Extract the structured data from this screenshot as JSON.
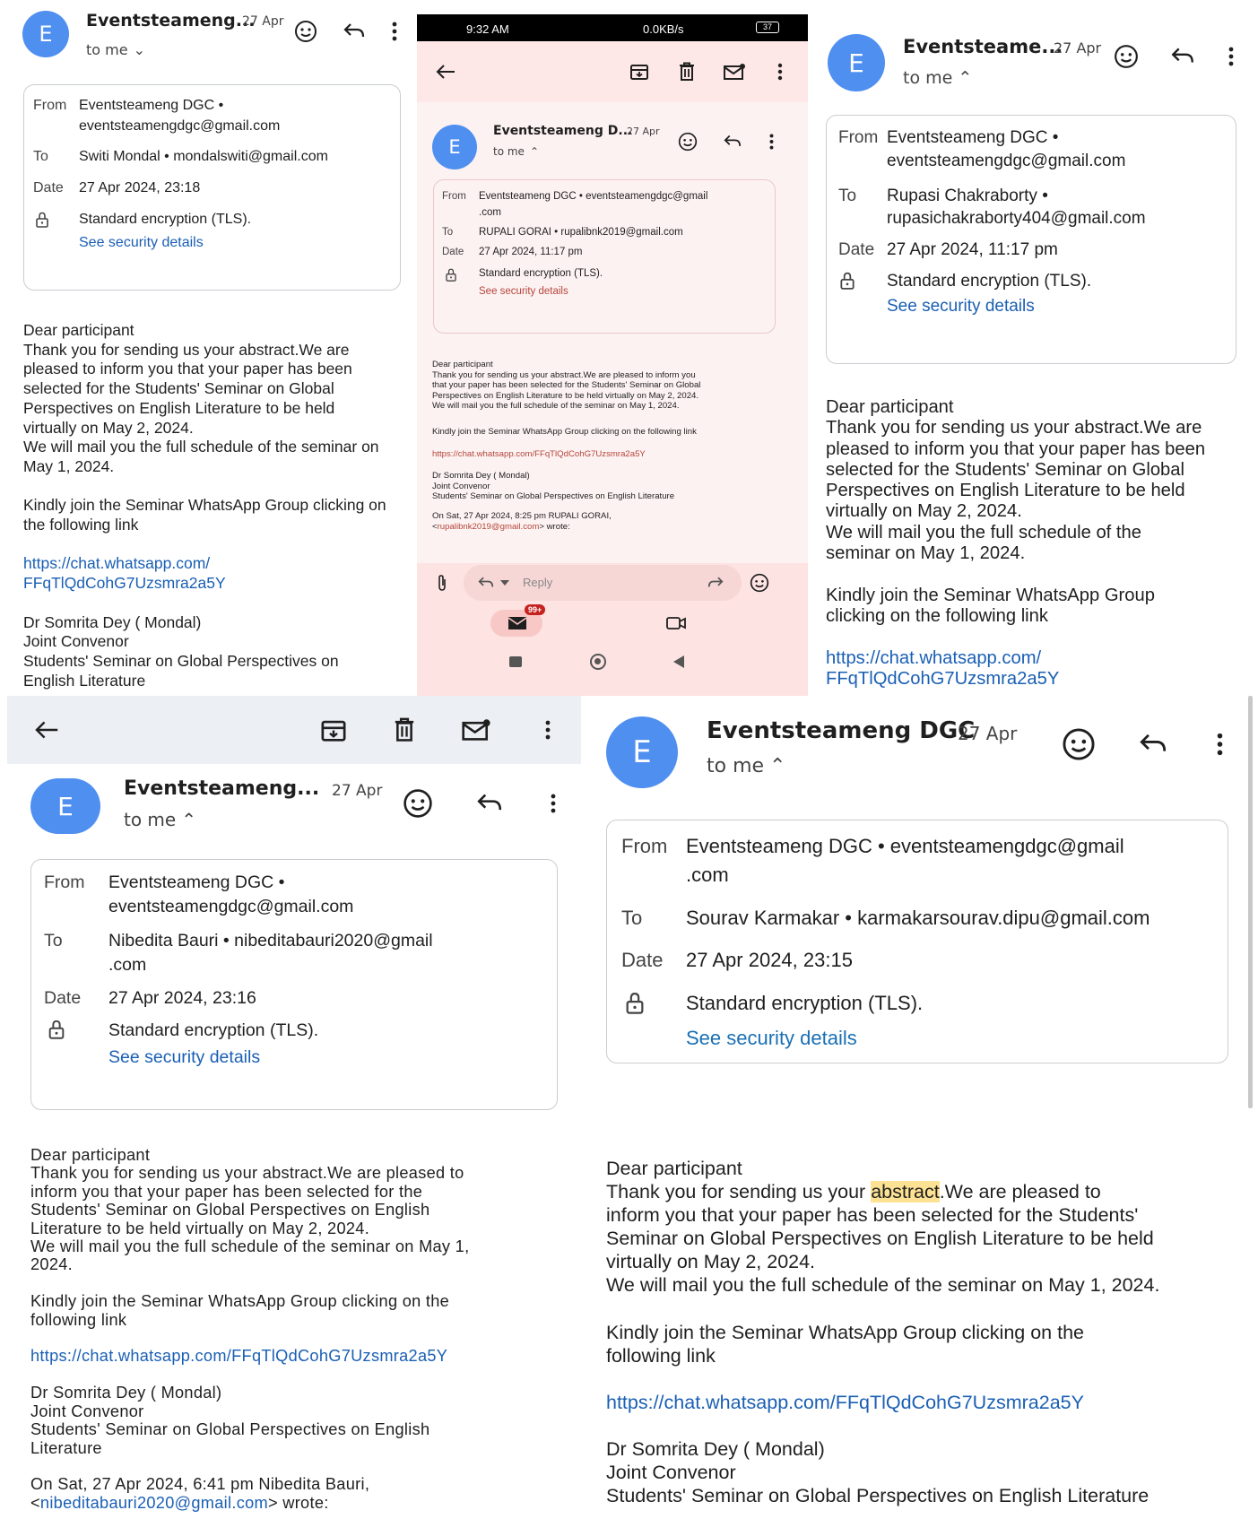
{
  "avatar_letter": "E",
  "panel1": {
    "sender": "Eventsteameng...",
    "date": "27 Apr",
    "recipient_line": "to me",
    "from_label": "From",
    "from_name": "Eventsteameng DGC •",
    "from_email": "eventsteamengdgc@gmail.com",
    "to_label": "To",
    "to_value": "Switi Mondal • mondalswiti@gmail.com",
    "date_label": "Date",
    "date_value": "27 Apr 2024, 23:18",
    "encryption": "Standard encryption (TLS).",
    "security_link": "See security details",
    "body": [
      "Dear participant",
      "Thank you for sending us your abstract.We are",
      "pleased to inform you that your paper has been",
      "selected for the Students' Seminar on Global",
      "Perspectives on English Literature to be held",
      "virtually on May 2, 2024.",
      "We will mail you the full schedule of the seminar on",
      "May 1, 2024.",
      "",
      "Kindly join the Seminar WhatsApp Group clicking on",
      "the following link",
      ""
    ],
    "link_lines": [
      "https://chat.whatsapp.com/",
      "FFqTlQdCohG7Uzsmra2a5Y"
    ],
    "signature": [
      "Dr Somrita Dey ( Mondal)",
      "Joint Convenor",
      "Students' Seminar on Global Perspectives on",
      "English Literature"
    ]
  },
  "panel2": {
    "status_time": "9:32 AM",
    "status_right": "0.0KB/s",
    "battery": "37",
    "sender": "Eventsteameng D...",
    "date": "27 Apr",
    "recipient_line": "to me",
    "from_label": "From",
    "from_value": "Eventsteameng DGC • eventsteamengdgc@gmail",
    "from_value_2": ".com",
    "to_label": "To",
    "to_value": "RUPALI GORAI • rupalibnk2019@gmail.com",
    "date_label": "Date",
    "date_value": "27 Apr 2024, 11:17 pm",
    "encryption": "Standard encryption (TLS).",
    "security_link": "See security details",
    "body": [
      "Dear participant",
      "Thank you for sending us your abstract.We are pleased to inform you",
      "that your paper has been selected for the Students' Seminar on Global",
      "Perspectives on English Literature to be held virtually on May 2, 2024.",
      "We will mail you the full schedule of the seminar on May 1, 2024."
    ],
    "join_line": "Kindly join the Seminar WhatsApp Group clicking on the following link",
    "link": "https://chat.whatsapp.com/FFqTlQdCohG7Uzsmra2a5Y",
    "signature": [
      "Dr Somrita Dey ( Mondal)",
      "Joint Convenor",
      "Students' Seminar on Global Perspectives on English Literature"
    ],
    "quote_line_1": "On Sat, 27 Apr 2024, 8:25 pm RUPALI GORAI,",
    "quote_email": "rupalibnk2019@gmail.com",
    "quote_line_2_pre": "<",
    "quote_line_2_post": "> wrote:",
    "reply_label": "Reply",
    "badge": "99+"
  },
  "panel3": {
    "sender": "Eventsteame...",
    "date": "27 Apr",
    "recipient_line": "to me",
    "from_label": "From",
    "from_name": "Eventsteameng DGC •",
    "from_email": "eventsteamengdgc@gmail.com",
    "to_label": "To",
    "to_name": "Rupasi Chakraborty •",
    "to_email": "rupasichakraborty404@gmail.com",
    "date_label": "Date",
    "date_value": "27 Apr 2024, 11:17 pm",
    "encryption": "Standard encryption (TLS).",
    "security_link": "See security details",
    "body": [
      "Dear participant",
      "Thank you for sending us your abstract.We are",
      "pleased to inform you that your paper has been",
      "selected for the Students' Seminar on Global",
      "Perspectives on English Literature to be held",
      "virtually on May 2, 2024.",
      "We will mail you the full schedule of the",
      "seminar on May 1, 2024.",
      "",
      "Kindly join the Seminar WhatsApp Group",
      "clicking on the following link",
      ""
    ],
    "link_lines": [
      "https://chat.whatsapp.com/",
      "FFqTlQdCohG7Uzsmra2a5Y"
    ]
  },
  "panel4": {
    "sender": "Eventsteameng...",
    "date": "27 Apr",
    "recipient_line": "to me",
    "from_label": "From",
    "from_name": "Eventsteameng DGC •",
    "from_email": "eventsteamengdgc@gmail.com",
    "to_label": "To",
    "to_value": "Nibedita Bauri • nibeditabauri2020@gmail",
    "to_value_2": ".com",
    "date_label": "Date",
    "date_value": "27 Apr 2024, 23:16",
    "encryption": "Standard encryption (TLS).",
    "security_link": "See security details",
    "body": [
      "Dear participant",
      "Thank you for sending us your abstract.We are pleased to",
      "inform you that your paper has been selected for the",
      "Students' Seminar on Global Perspectives on English",
      "Literature to be held virtually on May 2, 2024.",
      "We will mail you the full schedule of the seminar on May 1,",
      "2024.",
      "",
      "Kindly join the Seminar WhatsApp Group clicking on the",
      "following link",
      ""
    ],
    "link": "https://chat.whatsapp.com/FFqTlQdCohG7Uzsmra2a5Y",
    "signature": [
      "Dr Somrita Dey ( Mondal)",
      "Joint Convenor",
      "Students' Seminar on Global Perspectives on English",
      "Literature"
    ],
    "quote_line_1": "On Sat, 27 Apr 2024, 6:41 pm Nibedita Bauri,",
    "quote_pre": "<",
    "quote_email": "nibeditabauri2020@gmail.com",
    "quote_post": "> wrote:"
  },
  "panel5": {
    "sender": "Eventsteameng DGC",
    "date": "27 Apr",
    "recipient_line": "to me",
    "from_label": "From",
    "from_value": "Eventsteameng DGC • eventsteamengdgc@gmail",
    "from_value_2": ".com",
    "to_label": "To",
    "to_value": "Sourav Karmakar • karmakarsourav.dipu@gmail.com",
    "date_label": "Date",
    "date_value": "27 Apr 2024, 23:15",
    "encryption": "Standard encryption (TLS).",
    "security_link": "See security details",
    "body_1": "Dear participant",
    "body_2_pre": "Thank you for sending us your ",
    "body_2_hl": "abstract",
    "body_2_post": ".We are pleased to",
    "body_rest": [
      "inform you that your paper has been selected for the Students'",
      "Seminar on Global Perspectives on English Literature to be held",
      "virtually on May 2, 2024.",
      "We will mail you the full schedule of the seminar on May 1, 2024.",
      "",
      "Kindly join the Seminar WhatsApp Group clicking on the",
      "following link",
      ""
    ],
    "link": "https://chat.whatsapp.com/FFqTlQdCohG7Uzsmra2a5Y",
    "signature": [
      "Dr Somrita Dey ( Mondal)",
      "Joint Convenor",
      "Students' Seminar on Global Perspectives on English Literature"
    ]
  }
}
